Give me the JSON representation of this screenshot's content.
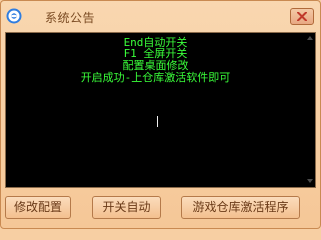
{
  "window": {
    "title": "系统公告"
  },
  "console": {
    "lines": [
      "End自动开关",
      "F1 全屏开关",
      "配置桌面修改",
      "开启成功-上仓库激活软件即可"
    ],
    "text_color": "#3aff3a",
    "background": "#000000"
  },
  "buttons": {
    "modify_config": "修改配置",
    "toggle_auto": "开关自动",
    "activate_program": "游戏仓库激活程序"
  },
  "colors": {
    "window_bg": "#f7cfa3",
    "button_text": "#6a3a18",
    "close_x": "#c0392b"
  },
  "icons": {
    "app": "app-logo-icon",
    "close": "close-icon",
    "scroll_up": "scroll-up-arrow-icon",
    "scroll_down": "scroll-down-arrow-icon"
  }
}
